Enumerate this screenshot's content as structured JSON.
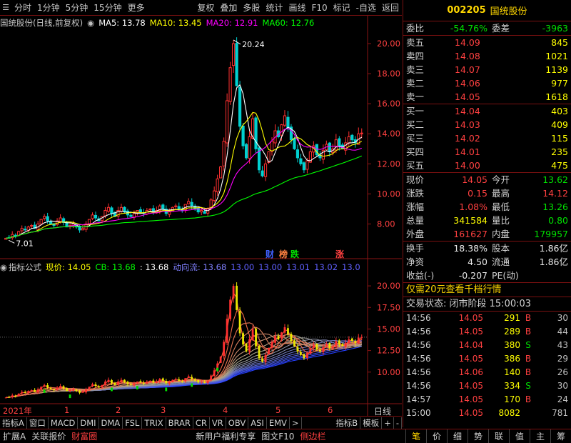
{
  "toolbar": {
    "left": [
      "分时",
      "1分钟",
      "5分钟",
      "15分钟",
      "更多"
    ],
    "right": [
      "复权",
      "叠加",
      "多股",
      "统计",
      "画线",
      "F10",
      "标记",
      "-自选",
      "返回"
    ]
  },
  "main_legend": {
    "name": "国统股份(日线,前复权)",
    "ma5": "MA5: 13.78",
    "ma10": "MA10: 13.45",
    "ma20": "MA20: 12.91",
    "ma60": "MA60: 12.76"
  },
  "main_annotations": {
    "high": "20.24",
    "low": "7.01",
    "cai": "财",
    "bang": "榜",
    "die": "跌",
    "zhang": "涨"
  },
  "ind_legend": {
    "name": "指标公式",
    "xj": "现价: 14.05",
    "cb": "CB: 13.68",
    "v1": ": 13.68",
    "dxl": "动向流: 13.68",
    "s1": "13.00",
    "s2": "13.00",
    "s3": "13.01",
    "s4": "13.02",
    "s5": "13.0"
  },
  "xaxis": {
    "year": "2021年",
    "ticks": [
      "1",
      "2",
      "3",
      "4",
      "5",
      "6"
    ],
    "period": "日线"
  },
  "tabs": [
    "指标A",
    "窗口",
    "MACD",
    "DMI",
    "DMA",
    "FSL",
    "TRIX",
    "BRAR",
    "CR",
    "VR",
    "OBV",
    "ASI",
    "EMV",
    ">",
    "指标B",
    "模板",
    "+",
    "-"
  ],
  "statusbar": {
    "left": [
      "扩展A",
      "关联报价",
      "财富圈"
    ],
    "promo": "新用户福利专享",
    "f10": "图文F10",
    "side": "侧边栏",
    "side_tabs": [
      "笔",
      "价",
      "细",
      "势",
      "联",
      "值",
      "主",
      "筹"
    ]
  },
  "quote": {
    "code": "002205",
    "name": "国统股份",
    "weibi_label": "委比",
    "weibi": "-54.76%",
    "weicha_label": "委差",
    "weicha": "-3963",
    "asks": [
      {
        "label": "卖五",
        "price": "14.09",
        "vol": "845"
      },
      {
        "label": "卖四",
        "price": "14.08",
        "vol": "1021"
      },
      {
        "label": "卖三",
        "price": "14.07",
        "vol": "1139"
      },
      {
        "label": "卖二",
        "price": "14.06",
        "vol": "977"
      },
      {
        "label": "卖一",
        "price": "14.05",
        "vol": "1618"
      }
    ],
    "bids": [
      {
        "label": "买一",
        "price": "14.04",
        "vol": "403"
      },
      {
        "label": "买二",
        "price": "14.03",
        "vol": "409"
      },
      {
        "label": "买三",
        "price": "14.02",
        "vol": "115"
      },
      {
        "label": "买四",
        "price": "14.01",
        "vol": "235"
      },
      {
        "label": "买五",
        "price": "14.00",
        "vol": "475"
      }
    ],
    "stats": [
      {
        "l1": "现价",
        "v1": "14.05",
        "c1": "red",
        "l2": "今开",
        "v2": "13.62",
        "c2": "grn"
      },
      {
        "l1": "涨跌",
        "v1": "0.15",
        "c1": "red",
        "l2": "最高",
        "v2": "14.12",
        "c2": "red"
      },
      {
        "l1": "涨幅",
        "v1": "1.08%",
        "c1": "red",
        "l2": "最低",
        "v2": "13.26",
        "c2": "grn"
      },
      {
        "l1": "总量",
        "v1": "341584",
        "c1": "yel",
        "l2": "量比",
        "v2": "0.80",
        "c2": "grn"
      },
      {
        "l1": "外盘",
        "v1": "161627",
        "c1": "red",
        "l2": "内盘",
        "v2": "179957",
        "c2": "grn"
      }
    ],
    "stats2": [
      {
        "l1": "换手",
        "v1": "18.38%",
        "c1": "wht",
        "l2": "股本",
        "v2": "1.86亿",
        "c2": "wht"
      },
      {
        "l1": "净资",
        "v1": "4.50",
        "c1": "wht",
        "l2": "流通",
        "v2": "1.86亿",
        "c2": "wht"
      },
      {
        "l1": "收益(-)",
        "v1": "-0.207",
        "c1": "wht",
        "l2": "PE(动)",
        "v2": "",
        "c2": "wht"
      }
    ],
    "promo": "仅需20元查看千档行情",
    "trade_state": "交易状态: 闭市阶段 15:00:03",
    "ticks": [
      {
        "t": "14:56",
        "p": "14.05",
        "v": "291",
        "bs": "B",
        "n": "30"
      },
      {
        "t": "14:56",
        "p": "14.05",
        "v": "289",
        "bs": "B",
        "n": "44"
      },
      {
        "t": "14:56",
        "p": "14.04",
        "v": "380",
        "bs": "S",
        "n": "43"
      },
      {
        "t": "14:56",
        "p": "14.05",
        "v": "386",
        "bs": "B",
        "n": "29"
      },
      {
        "t": "14:56",
        "p": "14.06",
        "v": "140",
        "bs": "B",
        "n": "26"
      },
      {
        "t": "14:56",
        "p": "14.05",
        "v": "334",
        "bs": "S",
        "n": "30"
      },
      {
        "t": "14:57",
        "p": "14.05",
        "v": "170",
        "bs": "B",
        "n": "24"
      },
      {
        "t": "15:00",
        "p": "14.05",
        "v": "8082",
        "bs": "",
        "n": "781"
      }
    ]
  },
  "chart_data": [
    {
      "type": "candlestick",
      "title": "国统股份(日线,前复权)",
      "yticks": [
        8.0,
        10.0,
        12.0,
        14.0,
        16.0,
        18.0,
        20.0
      ],
      "ylim": [
        6.5,
        21.0
      ],
      "close": [
        7.05,
        7.1,
        7.3,
        7.2,
        7.5,
        7.7,
        7.6,
        7.8,
        7.9,
        7.7,
        8.0,
        8.3,
        8.5,
        8.2,
        8.0,
        7.9,
        8.2,
        8.4,
        8.1,
        7.8,
        7.9,
        8.0,
        7.8,
        7.6,
        7.7,
        8.0,
        8.3,
        8.6,
        8.4,
        8.2,
        8.5,
        8.9,
        9.1,
        8.7,
        8.5,
        8.9,
        9.1,
        8.8,
        8.6,
        8.5,
        8.7,
        8.9,
        8.8,
        8.7,
        8.9,
        9.0,
        8.8,
        8.9,
        9.2,
        9.0,
        8.7,
        8.8,
        9.1,
        9.2,
        9.0,
        8.9,
        9.3,
        9.5,
        9.2,
        9.0,
        8.8,
        8.9,
        8.7,
        9.0,
        9.6,
        10.2,
        11.0,
        11.8,
        13.5,
        16.2,
        18.4,
        20.0,
        17.2,
        14.5,
        13.2,
        12.4,
        13.8,
        15.0,
        13.0,
        11.6,
        11.2,
        12.0,
        12.8,
        13.5,
        14.2,
        13.8,
        14.6,
        15.2,
        14.4,
        13.6,
        13.0,
        12.4,
        12.0,
        11.6,
        12.2,
        12.8,
        13.2,
        12.6,
        12.4,
        12.9,
        13.3,
        12.8,
        13.0,
        13.6,
        13.2,
        13.0,
        13.4,
        13.8,
        13.6,
        13.4,
        14.0,
        14.05
      ],
      "high_label": 20.24,
      "low_label": 7.01,
      "ma5_last": 13.78,
      "ma10_last": 13.45,
      "ma20_last": 12.91,
      "ma60_last": 12.76
    },
    {
      "type": "line",
      "title": "指标公式",
      "yticks": [
        10.0,
        12.5,
        15.0,
        17.5,
        20.0
      ],
      "ylim": [
        6.5,
        21.5
      ]
    }
  ]
}
